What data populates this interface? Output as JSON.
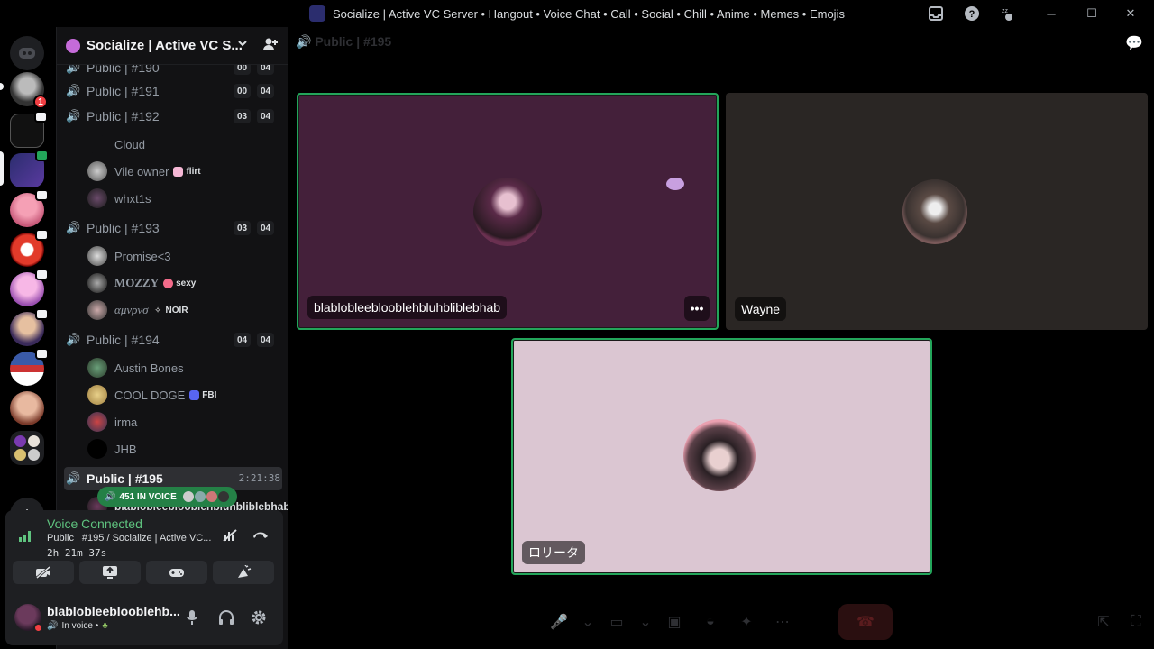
{
  "window": {
    "title": "Socialize | Active VC Server • Hangout • Voice Chat • Call • Social • Chill • Anime • Memes • Emojis",
    "icons": [
      "inbox-icon",
      "help-icon",
      "sleep-icon"
    ],
    "controls": {
      "minimize": "─",
      "maximize": "☐",
      "close": "✕"
    }
  },
  "server": {
    "name": "Socialize | Active VC S...",
    "badge": "1",
    "add_glyph": "+"
  },
  "channels": [
    {
      "name": "Public | #190",
      "count_a": "00",
      "count_b": "04"
    },
    {
      "name": "Public | #191",
      "count_a": "00",
      "count_b": "04"
    },
    {
      "name": "Public | #192",
      "count_a": "03",
      "count_b": "04",
      "users": [
        {
          "name": "Cloud"
        },
        {
          "name": "Vile owner",
          "tag": "flirt"
        },
        {
          "name": "whxt1s"
        }
      ]
    },
    {
      "name": "Public | #193",
      "count_a": "03",
      "count_b": "04",
      "users": [
        {
          "name": "Promise<3"
        },
        {
          "name": "MOZZY",
          "tag": "sexy"
        },
        {
          "name": "αμνρνσ",
          "tag": "NOIR"
        }
      ]
    },
    {
      "name": "Public | #194",
      "count_a": "04",
      "count_b": "04",
      "users": [
        {
          "name": "Austin Bones"
        },
        {
          "name": "COOL DOGE",
          "tag": "FBI"
        },
        {
          "name": "irma"
        },
        {
          "name": "JHB"
        }
      ]
    },
    {
      "name": "Public | #195",
      "timer": "2:21:38",
      "users": [
        {
          "name": "blablobleeblooblehbluhbliblebhab"
        }
      ]
    }
  ],
  "voice_pill": {
    "label": "451 IN VOICE"
  },
  "voice_panel": {
    "title": "Voice Connected",
    "subtitle": "Public | #195 / Socialize | Active VC...",
    "elapsed": "2h 21m 37s"
  },
  "user_bar": {
    "name": "blablobleeblooblehb...",
    "status": "In voice •"
  },
  "stage": {
    "channel_title": "Public | #195",
    "tiles": [
      {
        "name": "blablobleeblooblehbluhbliblebhab",
        "more": "•••"
      },
      {
        "name": "Wayne"
      },
      {
        "name": "ロリータ"
      }
    ]
  },
  "colors": {
    "speaking": "#23a55a",
    "voice_green": "#5fc37f",
    "tile1_bg": "#44203a",
    "tile2_bg": "#2a2624",
    "tile3_bg": "#dbc6d2"
  }
}
